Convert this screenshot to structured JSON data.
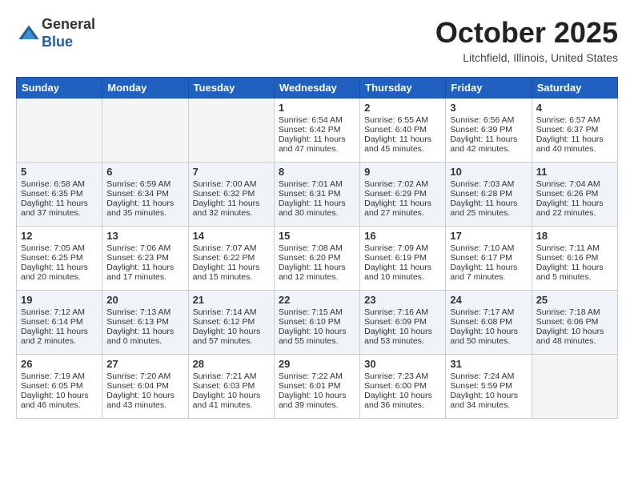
{
  "header": {
    "logo_line1": "General",
    "logo_line2": "Blue",
    "month_title": "October 2025",
    "location": "Litchfield, Illinois, United States"
  },
  "weekdays": [
    "Sunday",
    "Monday",
    "Tuesday",
    "Wednesday",
    "Thursday",
    "Friday",
    "Saturday"
  ],
  "weeks": [
    [
      {
        "day": "",
        "info": ""
      },
      {
        "day": "",
        "info": ""
      },
      {
        "day": "",
        "info": ""
      },
      {
        "day": "1",
        "info": "Sunrise: 6:54 AM\nSunset: 6:42 PM\nDaylight: 11 hours\nand 47 minutes."
      },
      {
        "day": "2",
        "info": "Sunrise: 6:55 AM\nSunset: 6:40 PM\nDaylight: 11 hours\nand 45 minutes."
      },
      {
        "day": "3",
        "info": "Sunrise: 6:56 AM\nSunset: 6:39 PM\nDaylight: 11 hours\nand 42 minutes."
      },
      {
        "day": "4",
        "info": "Sunrise: 6:57 AM\nSunset: 6:37 PM\nDaylight: 11 hours\nand 40 minutes."
      }
    ],
    [
      {
        "day": "5",
        "info": "Sunrise: 6:58 AM\nSunset: 6:35 PM\nDaylight: 11 hours\nand 37 minutes."
      },
      {
        "day": "6",
        "info": "Sunrise: 6:59 AM\nSunset: 6:34 PM\nDaylight: 11 hours\nand 35 minutes."
      },
      {
        "day": "7",
        "info": "Sunrise: 7:00 AM\nSunset: 6:32 PM\nDaylight: 11 hours\nand 32 minutes."
      },
      {
        "day": "8",
        "info": "Sunrise: 7:01 AM\nSunset: 6:31 PM\nDaylight: 11 hours\nand 30 minutes."
      },
      {
        "day": "9",
        "info": "Sunrise: 7:02 AM\nSunset: 6:29 PM\nDaylight: 11 hours\nand 27 minutes."
      },
      {
        "day": "10",
        "info": "Sunrise: 7:03 AM\nSunset: 6:28 PM\nDaylight: 11 hours\nand 25 minutes."
      },
      {
        "day": "11",
        "info": "Sunrise: 7:04 AM\nSunset: 6:26 PM\nDaylight: 11 hours\nand 22 minutes."
      }
    ],
    [
      {
        "day": "12",
        "info": "Sunrise: 7:05 AM\nSunset: 6:25 PM\nDaylight: 11 hours\nand 20 minutes."
      },
      {
        "day": "13",
        "info": "Sunrise: 7:06 AM\nSunset: 6:23 PM\nDaylight: 11 hours\nand 17 minutes."
      },
      {
        "day": "14",
        "info": "Sunrise: 7:07 AM\nSunset: 6:22 PM\nDaylight: 11 hours\nand 15 minutes."
      },
      {
        "day": "15",
        "info": "Sunrise: 7:08 AM\nSunset: 6:20 PM\nDaylight: 11 hours\nand 12 minutes."
      },
      {
        "day": "16",
        "info": "Sunrise: 7:09 AM\nSunset: 6:19 PM\nDaylight: 11 hours\nand 10 minutes."
      },
      {
        "day": "17",
        "info": "Sunrise: 7:10 AM\nSunset: 6:17 PM\nDaylight: 11 hours\nand 7 minutes."
      },
      {
        "day": "18",
        "info": "Sunrise: 7:11 AM\nSunset: 6:16 PM\nDaylight: 11 hours\nand 5 minutes."
      }
    ],
    [
      {
        "day": "19",
        "info": "Sunrise: 7:12 AM\nSunset: 6:14 PM\nDaylight: 11 hours\nand 2 minutes."
      },
      {
        "day": "20",
        "info": "Sunrise: 7:13 AM\nSunset: 6:13 PM\nDaylight: 11 hours\nand 0 minutes."
      },
      {
        "day": "21",
        "info": "Sunrise: 7:14 AM\nSunset: 6:12 PM\nDaylight: 10 hours\nand 57 minutes."
      },
      {
        "day": "22",
        "info": "Sunrise: 7:15 AM\nSunset: 6:10 PM\nDaylight: 10 hours\nand 55 minutes."
      },
      {
        "day": "23",
        "info": "Sunrise: 7:16 AM\nSunset: 6:09 PM\nDaylight: 10 hours\nand 53 minutes."
      },
      {
        "day": "24",
        "info": "Sunrise: 7:17 AM\nSunset: 6:08 PM\nDaylight: 10 hours\nand 50 minutes."
      },
      {
        "day": "25",
        "info": "Sunrise: 7:18 AM\nSunset: 6:06 PM\nDaylight: 10 hours\nand 48 minutes."
      }
    ],
    [
      {
        "day": "26",
        "info": "Sunrise: 7:19 AM\nSunset: 6:05 PM\nDaylight: 10 hours\nand 46 minutes."
      },
      {
        "day": "27",
        "info": "Sunrise: 7:20 AM\nSunset: 6:04 PM\nDaylight: 10 hours\nand 43 minutes."
      },
      {
        "day": "28",
        "info": "Sunrise: 7:21 AM\nSunset: 6:03 PM\nDaylight: 10 hours\nand 41 minutes."
      },
      {
        "day": "29",
        "info": "Sunrise: 7:22 AM\nSunset: 6:01 PM\nDaylight: 10 hours\nand 39 minutes."
      },
      {
        "day": "30",
        "info": "Sunrise: 7:23 AM\nSunset: 6:00 PM\nDaylight: 10 hours\nand 36 minutes."
      },
      {
        "day": "31",
        "info": "Sunrise: 7:24 AM\nSunset: 5:59 PM\nDaylight: 10 hours\nand 34 minutes."
      },
      {
        "day": "",
        "info": ""
      }
    ]
  ]
}
